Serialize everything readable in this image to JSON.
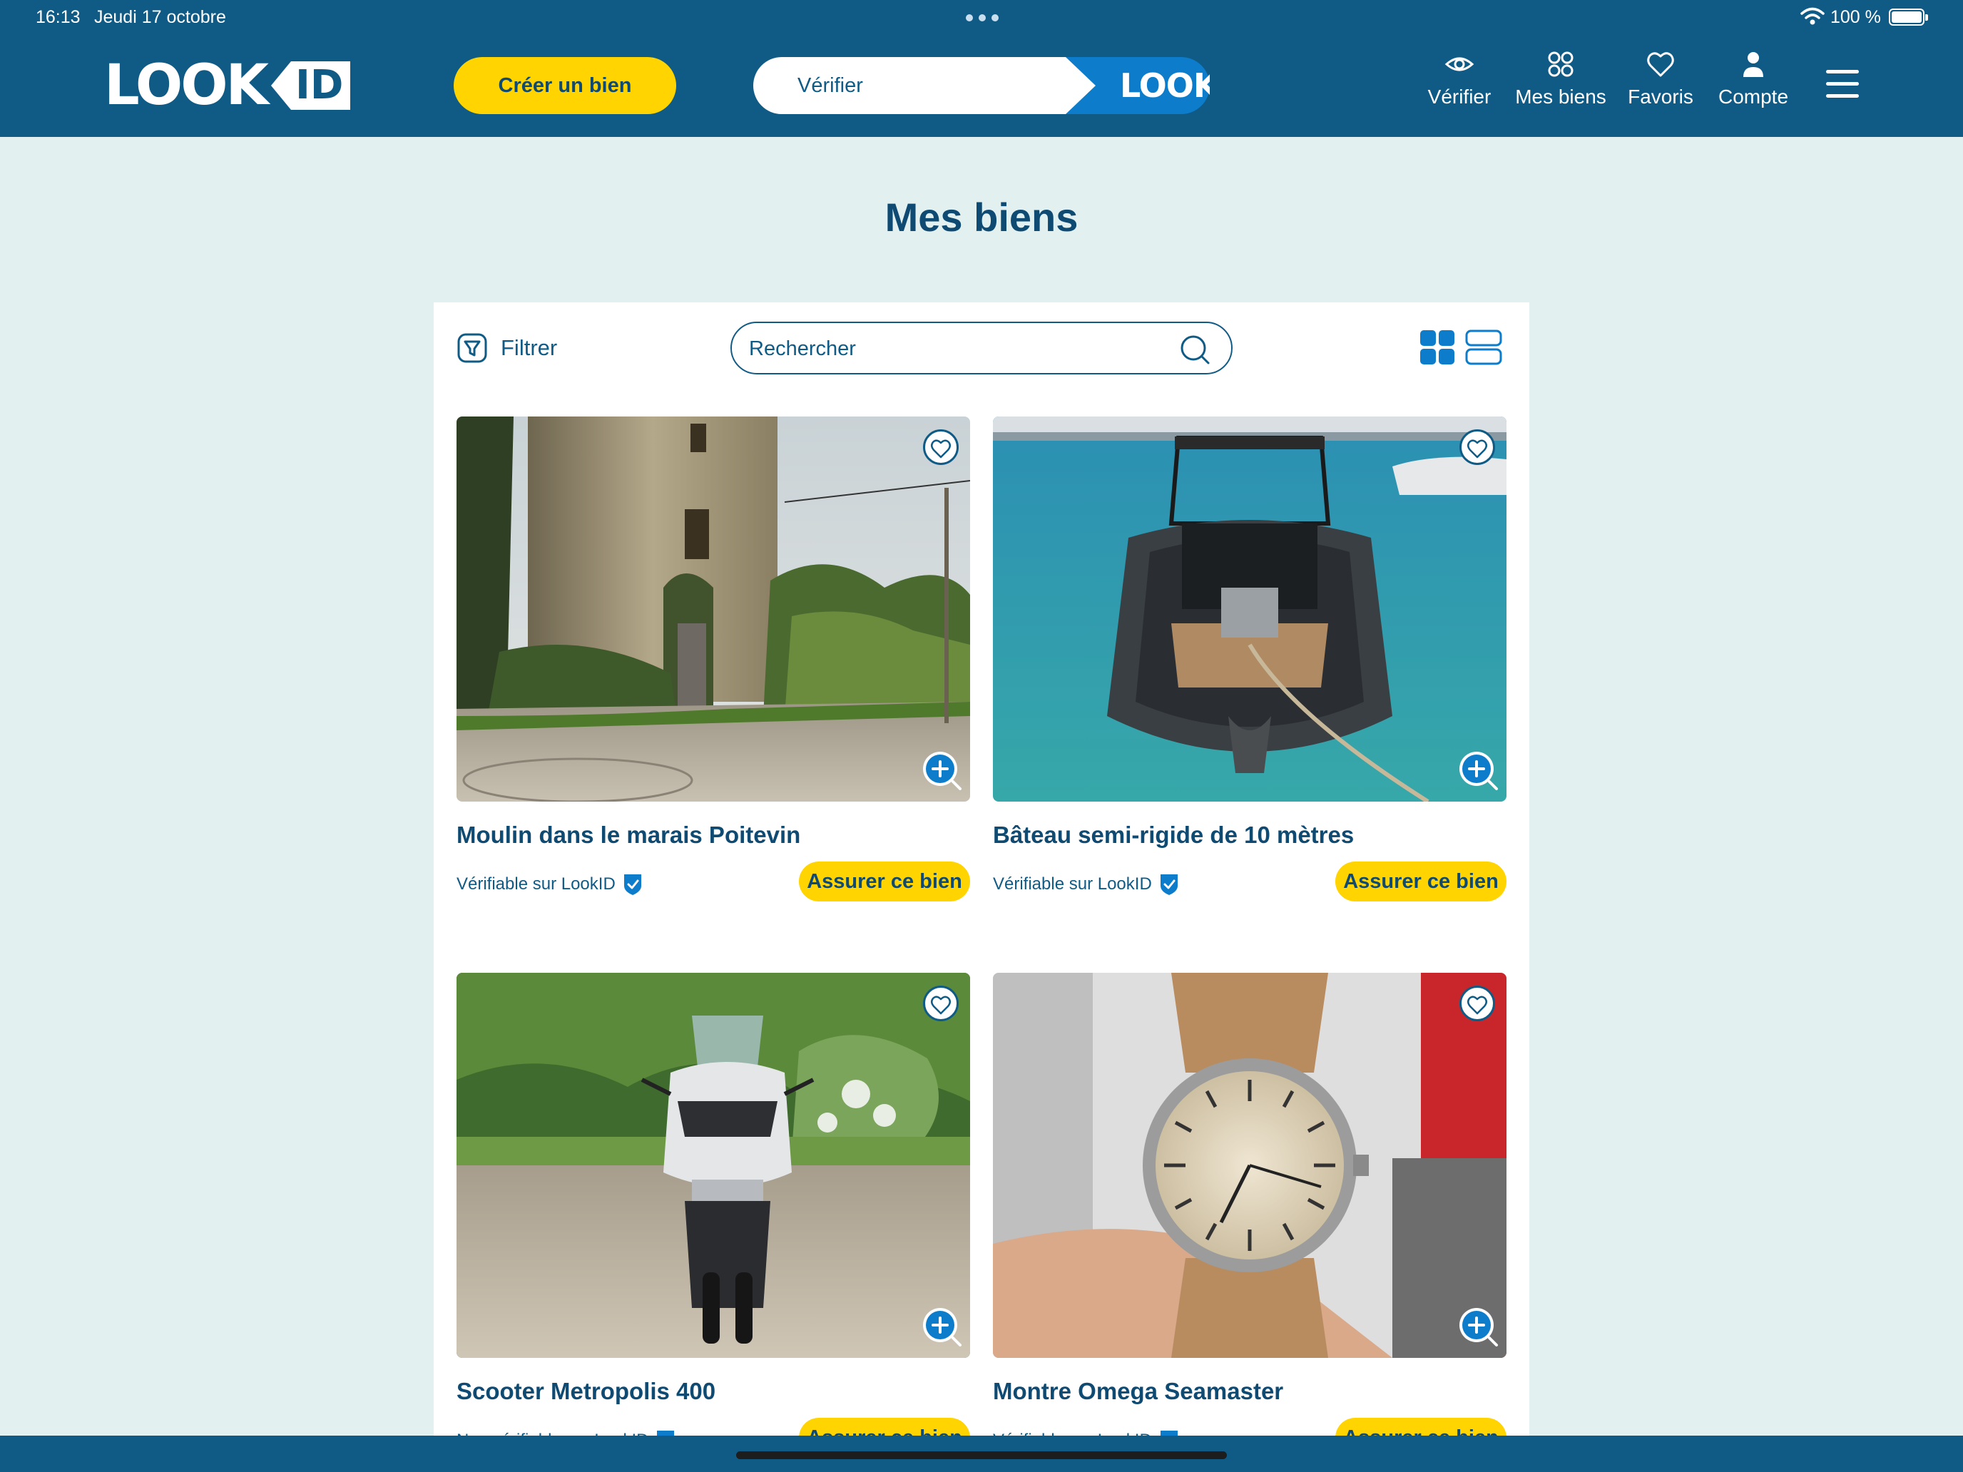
{
  "status_bar": {
    "time": "16:13",
    "date": "Jeudi 17 octobre",
    "battery": "100 %"
  },
  "header": {
    "logo_text": "LOOK",
    "logo_badge": "ID",
    "create_label": "Créer un bien",
    "verify_placeholder": "Vérifier",
    "verify_button": "LOOK",
    "nav": [
      {
        "label": "Vérifier",
        "icon": "eye-icon"
      },
      {
        "label": "Mes biens",
        "icon": "grid-icon"
      },
      {
        "label": "Favoris",
        "icon": "heart-icon"
      },
      {
        "label": "Compte",
        "icon": "user-icon"
      }
    ],
    "menu_icon": "hamburger-icon"
  },
  "page": {
    "title": "Mes biens"
  },
  "toolbar": {
    "filter_label": "Filtrer",
    "search_placeholder": "Rechercher",
    "view_modes": [
      "grid-view-icon",
      "list-view-icon"
    ]
  },
  "items": [
    {
      "title": "Moulin dans le marais Poitevin",
      "status": "Vérifiable sur LookID",
      "action": "Assurer ce bien"
    },
    {
      "title": "Bâteau semi-rigide de 10 mètres",
      "status": "Vérifiable sur LookID",
      "action": "Assurer ce bien"
    },
    {
      "title": "Scooter Metropolis 400",
      "status": "Non vérifiable sur LookID",
      "action": "Assurer ce bien"
    },
    {
      "title": "Montre Omega Seamaster",
      "status": "Vérifiable sur LookID",
      "action": "Assurer ce bien"
    }
  ],
  "colors": {
    "header": "#0f5b86",
    "accent": "#ffd400",
    "background": "#e3f0f0",
    "primary_text": "#0e4a72"
  }
}
